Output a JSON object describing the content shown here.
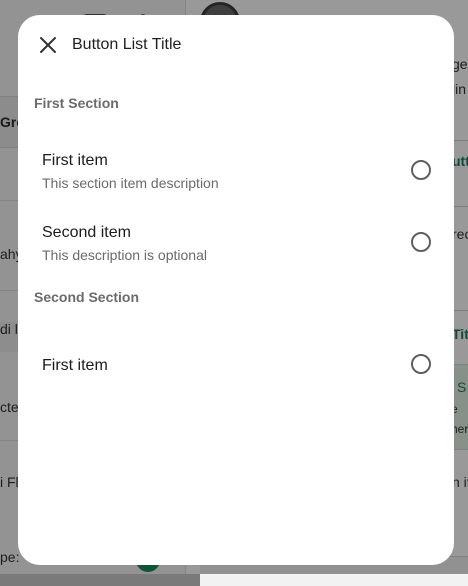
{
  "background": {
    "left_panel_header": "Gro",
    "left_texts": [
      "ahyi",
      "di la",
      "cted",
      "i Fl",
      "pe:"
    ],
    "right_texts": [
      "ge",
      "lin",
      "utt",
      "rec",
      "Tit",
      "n it"
    ],
    "green_card_texts": [
      "S",
      "e",
      "her"
    ]
  },
  "dialog": {
    "title": "Button List Title",
    "close_icon": "close-icon",
    "sections": [
      {
        "header": "First Section",
        "items": [
          {
            "title": "First item",
            "description": "This section item description",
            "selected": false
          },
          {
            "title": "Second item",
            "description": "This description is optional",
            "selected": false
          }
        ]
      },
      {
        "header": "Second Section",
        "items": [
          {
            "title": "First item",
            "selected": false
          }
        ]
      }
    ]
  },
  "colors": {
    "scrim": "#00000066",
    "dialog_bg": "#ffffff",
    "radio_border": "#5f5f5f",
    "section_header": "#6b6b6b"
  }
}
